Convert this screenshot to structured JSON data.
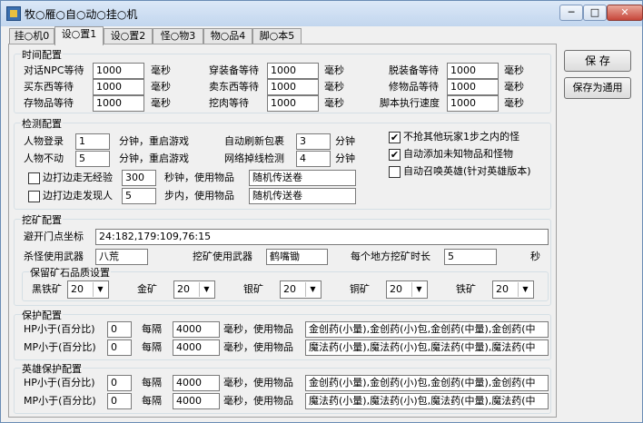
{
  "window": {
    "title": "牧○雁○自○动○挂○机",
    "minimize": "─",
    "maximize": "□",
    "close": "✕"
  },
  "tabs": [
    "挂○机0",
    "设○置1",
    "设○置2",
    "怪○物3",
    "物○品4",
    "脚○本5"
  ],
  "buttons": {
    "save": "保  存",
    "save_as_default": "保存为通用"
  },
  "time_config": {
    "title": "时间配置",
    "rows": [
      {
        "label": "对话NPC等待",
        "value": "1000",
        "unit": "毫秒"
      },
      {
        "label": "穿装备等待",
        "value": "1000",
        "unit": "毫秒"
      },
      {
        "label": "脱装备等待",
        "value": "1000",
        "unit": "毫秒"
      },
      {
        "label": "买东西等待",
        "value": "1000",
        "unit": "毫秒"
      },
      {
        "label": "卖东西等待",
        "value": "1000",
        "unit": "毫秒"
      },
      {
        "label": "修物品等待",
        "value": "1000",
        "unit": "毫秒"
      },
      {
        "label": "存物品等待",
        "value": "1000",
        "unit": "毫秒"
      },
      {
        "label": "挖肉等待",
        "value": "1000",
        "unit": "毫秒"
      },
      {
        "label": "脚本执行速度",
        "value": "1000",
        "unit": "毫秒"
      }
    ]
  },
  "detect_config": {
    "title": "检测配置",
    "login": {
      "label": "人物登录",
      "value": "1",
      "unit": "分钟，重启游戏"
    },
    "idle": {
      "label": "人物不动",
      "value": "5",
      "unit": "分钟，重启游戏"
    },
    "refresh_bag": {
      "label": "自动刷新包裹",
      "value": "3",
      "unit": "分钟"
    },
    "net_check": {
      "label": "网络掉线检测",
      "value": "4",
      "unit": "分钟"
    },
    "no_exp": {
      "label": "边打边走无经验",
      "checked": false,
      "value": "300",
      "unit": "秒钟，使用物品",
      "item": "随机传送卷"
    },
    "find_player": {
      "label": "边打边走发现人",
      "checked": false,
      "value": "5",
      "unit": "步内，使用物品",
      "item": "随机传送卷"
    },
    "options": [
      {
        "label": "不抢其他玩家1步之内的怪",
        "checked": true
      },
      {
        "label": "自动添加未知物品和怪物",
        "checked": true
      },
      {
        "label": "自动召唤英雄(针对英雄版本)",
        "checked": false
      }
    ]
  },
  "mining_config": {
    "title": "挖矿配置",
    "avoid_door": {
      "label": "避开门点坐标",
      "value": "24:182,179:109,76:15"
    },
    "kill_weapon": {
      "label": "杀怪使用武器",
      "value": "八荒"
    },
    "mine_weapon": {
      "label": "挖矿使用武器",
      "value": "鹤嘴锄"
    },
    "mine_time": {
      "label": "每个地方挖矿时长",
      "value": "5",
      "unit": "秒"
    },
    "quality": {
      "title": "保留矿石品质设置",
      "ores": [
        {
          "label": "黑铁矿",
          "value": "20"
        },
        {
          "label": "金矿",
          "value": "20"
        },
        {
          "label": "银矿",
          "value": "20"
        },
        {
          "label": "铜矿",
          "value": "20"
        },
        {
          "label": "铁矿",
          "value": "20"
        }
      ]
    }
  },
  "protect_config": {
    "title": "保护配置",
    "hp": {
      "label": "HP小于(百分比)",
      "value": "0",
      "every": "每隔",
      "interval": "4000",
      "unit": "毫秒，使用物品",
      "items": "金创药(小量),金创药(小)包,金创药(中量),金创药(中"
    },
    "mp": {
      "label": "MP小于(百分比)",
      "value": "0",
      "every": "每隔",
      "interval": "4000",
      "unit": "毫秒，使用物品",
      "items": "魔法药(小量),魔法药(小)包,魔法药(中量),魔法药(中"
    }
  },
  "hero_protect_config": {
    "title": "英雄保护配置",
    "hp": {
      "label": "HP小于(百分比)",
      "value": "0",
      "every": "每隔",
      "interval": "4000",
      "unit": "毫秒，使用物品",
      "items": "金创药(小量),金创药(小)包,金创药(中量),金创药(中"
    },
    "mp": {
      "label": "MP小于(百分比)",
      "value": "0",
      "every": "每隔",
      "interval": "4000",
      "unit": "毫秒，使用物品",
      "items": "魔法药(小量),魔法药(小)包,魔法药(中量),魔法药(中"
    }
  }
}
